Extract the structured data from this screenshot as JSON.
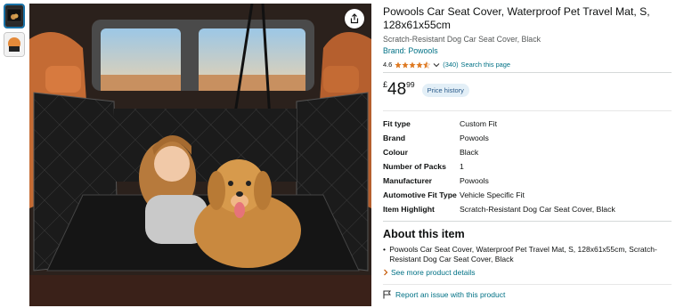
{
  "product": {
    "title": "Powools Car Seat Cover, Waterproof Pet Travel Mat, S, 128x61x55cm",
    "subtitle": "Scratch-Resistant Dog Car Seat Cover, Black",
    "brand_link": "Brand: Powools",
    "rating_value": "4.6",
    "rating_count": "(340)",
    "search_link": "Search this page",
    "stars_filled": 4.6
  },
  "price": {
    "currency": "£",
    "whole": "48",
    "fraction": "99",
    "history_label": "Price history"
  },
  "details": [
    {
      "label": "Fit type",
      "value": "Custom Fit"
    },
    {
      "label": "Brand",
      "value": "Powools"
    },
    {
      "label": "Colour",
      "value": "Black"
    },
    {
      "label": "Number of Packs",
      "value": "1"
    },
    {
      "label": "Manufacturer",
      "value": "Powools"
    },
    {
      "label": "Automotive Fit Type",
      "value": "Vehicle Specific Fit"
    },
    {
      "label": "Item Highlight",
      "value": "Scratch-Resistant Dog Car Seat Cover, Black"
    }
  ],
  "about": {
    "heading": "About this item",
    "bullets": [
      "Powools Car Seat Cover, Waterproof Pet Travel Mat, S, 128x61x55cm, Scratch-Resistant Dog Car Seat Cover, Black"
    ],
    "more_link": "See more product details"
  },
  "report": {
    "label": "Report an issue with this product"
  },
  "icons": {
    "share": "share-icon",
    "flag": "flag-icon",
    "chevron": "chevron-down-icon",
    "arrow": "chevron-right-icon"
  },
  "colors": {
    "link": "#007185",
    "star": "#de7921",
    "price_history_bg": "#e3eff7"
  }
}
